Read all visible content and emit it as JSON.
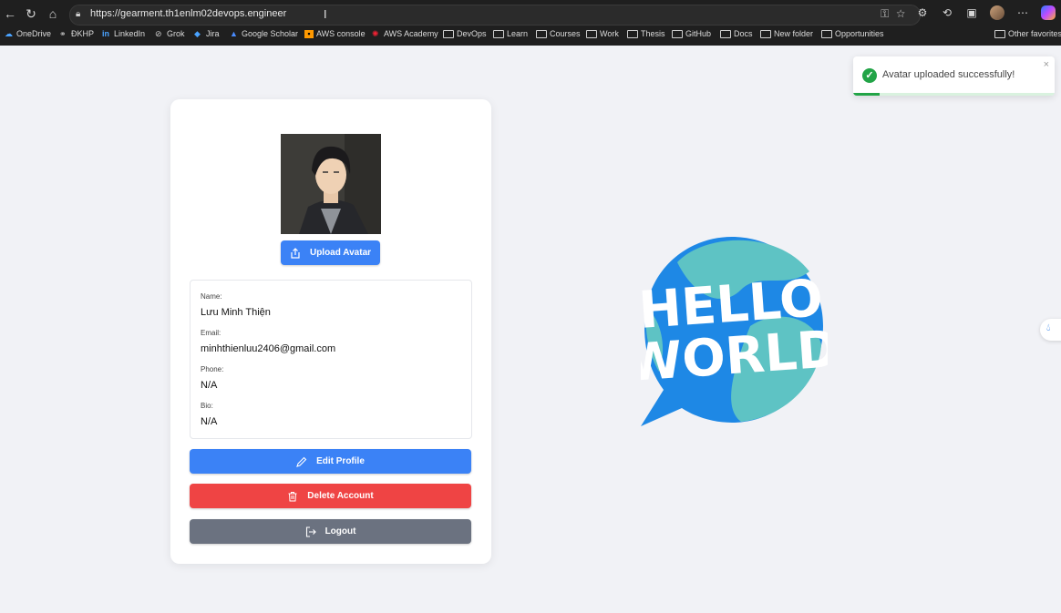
{
  "browser": {
    "url": "https://gearment.th1enlm02devops.engineer",
    "bookmarks": [
      {
        "label": "OneDrive",
        "icon": "cloud-icon"
      },
      {
        "label": "ĐKHP",
        "icon": "link-icon"
      },
      {
        "label": "LinkedIn",
        "icon": "linkedin-icon"
      },
      {
        "label": "Grok",
        "icon": "grok-icon"
      },
      {
        "label": "Jira",
        "icon": "jira-icon"
      },
      {
        "label": "Google Scholar",
        "icon": "scholar-icon"
      },
      {
        "label": "AWS console",
        "icon": "aws-icon"
      },
      {
        "label": "AWS Academy",
        "icon": "aws-academy-icon"
      },
      {
        "label": "DevOps",
        "icon": "folder-icon"
      },
      {
        "label": "Learn",
        "icon": "folder-icon"
      },
      {
        "label": "Courses",
        "icon": "folder-icon"
      },
      {
        "label": "Work",
        "icon": "folder-icon"
      },
      {
        "label": "Thesis",
        "icon": "folder-icon"
      },
      {
        "label": "GitHub",
        "icon": "folder-icon"
      },
      {
        "label": "Docs",
        "icon": "folder-icon"
      },
      {
        "label": "New folder",
        "icon": "folder-icon"
      },
      {
        "label": "Opportunities",
        "icon": "folder-icon"
      }
    ],
    "other_favorites": "Other favorites"
  },
  "profile": {
    "upload_label": "Upload Avatar",
    "fields": [
      {
        "label": "Name:",
        "value": "Lưu Minh Thiện"
      },
      {
        "label": "Email:",
        "value": "minhthienluu2406@gmail.com"
      },
      {
        "label": "Phone:",
        "value": "N/A"
      },
      {
        "label": "Bio:",
        "value": "N/A"
      }
    ],
    "edit_label": "Edit Profile",
    "delete_label": "Delete Account",
    "logout_label": "Logout"
  },
  "toast": {
    "message": "Avatar uploaded successfully!",
    "progress": 0.13,
    "close": "×"
  },
  "illustration": {
    "line1": "HELLO",
    "line2": "WORLD"
  },
  "colors": {
    "primary": "#3b82f6",
    "danger": "#ef4444",
    "secondary": "#6b7280",
    "success": "#22a447"
  }
}
